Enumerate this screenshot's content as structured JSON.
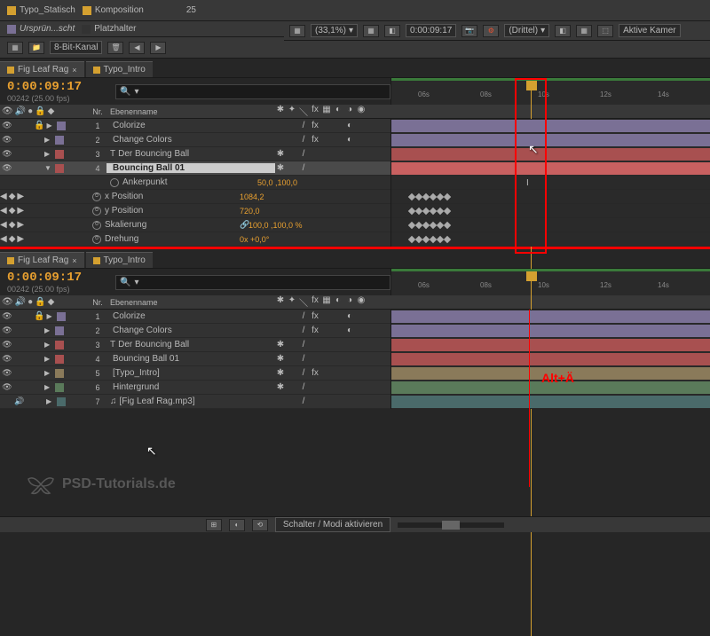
{
  "top": {
    "item1": "Typo_Statisch",
    "item2": "Komposition",
    "count": "25",
    "item3": "Ursprün...scht",
    "item4": "Platzhalter",
    "channel": "8-Bit-Kanal"
  },
  "preview": {
    "zoom": "(33,1%)",
    "time": "0:00:09:17",
    "grid": "(Drittel)",
    "camera": "Aktive Kamer"
  },
  "panel1": {
    "tabs": [
      {
        "label": "Fig Leaf Rag",
        "active": true
      },
      {
        "label": "Typo_Intro",
        "active": false
      }
    ],
    "timecode": "0:00:09:17",
    "timecode_sub": "00242 (25.00 fps)",
    "search_placeholder": "",
    "ruler_ticks": [
      "06s",
      "08s",
      "10s",
      "12s",
      "14s"
    ],
    "header": {
      "nr": "Nr.",
      "name": "Ebenenname"
    },
    "layers": [
      {
        "nr": "1",
        "name": "Colorize",
        "color": "#7a7095",
        "selected": false
      },
      {
        "nr": "2",
        "name": "Change Colors",
        "color": "#7a7095",
        "selected": false
      },
      {
        "nr": "3",
        "name": "Der Bouncing Ball",
        "color": "#a85050",
        "selected": false
      },
      {
        "nr": "4",
        "name": "Bouncing Ball 01",
        "color": "#a85050",
        "selected": true
      }
    ],
    "props": [
      {
        "name": "Ankerpunkt",
        "value": "50,0 ,100,0",
        "keyframes": false
      },
      {
        "name": "x Position",
        "value": "1084,2",
        "keyframes": true
      },
      {
        "name": "y Position",
        "value": "720,0",
        "keyframes": true
      },
      {
        "name": "Skalierung",
        "value": "100,0 ,100,0 %",
        "keyframes": true,
        "link": true
      },
      {
        "name": "Drehung",
        "value": "0x +0,0°",
        "keyframes": true
      }
    ]
  },
  "panel2": {
    "tabs": [
      {
        "label": "Fig Leaf Rag",
        "active": true
      },
      {
        "label": "Typo_Intro",
        "active": false
      }
    ],
    "timecode": "0:00:09:17",
    "timecode_sub": "00242 (25.00 fps)",
    "ruler_ticks": [
      "06s",
      "08s",
      "10s",
      "12s",
      "14s"
    ],
    "header": {
      "nr": "Nr.",
      "name": "Ebenenname"
    },
    "layers": [
      {
        "nr": "1",
        "name": "Colorize",
        "color": "#7a7095"
      },
      {
        "nr": "2",
        "name": "Change Colors",
        "color": "#7a7095"
      },
      {
        "nr": "3",
        "name": "Der Bouncing Ball",
        "color": "#a85050"
      },
      {
        "nr": "4",
        "name": "Bouncing Ball 01",
        "color": "#a85050"
      },
      {
        "nr": "5",
        "name": "[Typo_Intro]",
        "color": "#8a7a5a",
        "comp": true
      },
      {
        "nr": "6",
        "name": "Hintergrund",
        "color": "#5a7a5a"
      },
      {
        "nr": "7",
        "name": "[Fig Leaf Rag.mp3]",
        "color": "#4a6a6a",
        "audio": true
      }
    ]
  },
  "annotation": "Alt+Ä",
  "logo": "PSD-Tutorials.de",
  "footer": {
    "mode": "Schalter / Modi aktivieren"
  }
}
